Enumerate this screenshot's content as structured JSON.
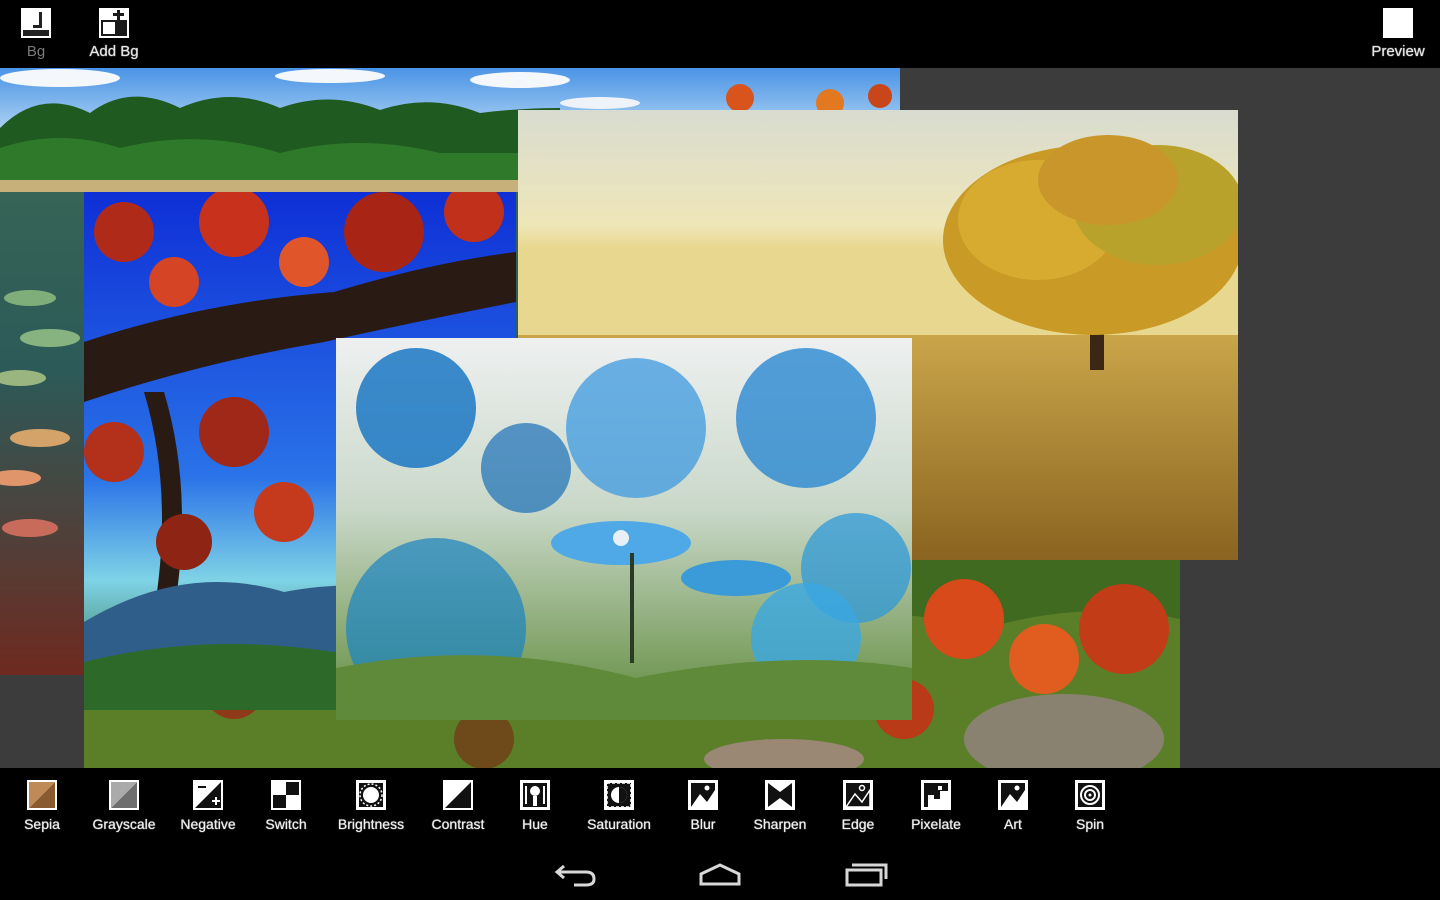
{
  "topbar": {
    "bg_label": "Bg",
    "add_bg_label": "Add Bg",
    "preview_label": "Preview"
  },
  "filters": [
    {
      "label": "Sepia",
      "icon": "sepia-icon"
    },
    {
      "label": "Grayscale",
      "icon": "grayscale-icon"
    },
    {
      "label": "Negative",
      "icon": "negative-icon"
    },
    {
      "label": "Switch",
      "icon": "switch-icon"
    },
    {
      "label": "Brightness",
      "icon": "brightness-icon"
    },
    {
      "label": "Contrast",
      "icon": "contrast-icon"
    },
    {
      "label": "Hue",
      "icon": "hue-icon"
    },
    {
      "label": "Saturation",
      "icon": "saturation-icon"
    },
    {
      "label": "Blur",
      "icon": "blur-icon"
    },
    {
      "label": "Sharpen",
      "icon": "sharpen-icon"
    },
    {
      "label": "Edge",
      "icon": "edge-icon"
    },
    {
      "label": "Pixelate",
      "icon": "pixelate-icon"
    },
    {
      "label": "Art",
      "icon": "art-icon"
    },
    {
      "label": "Spin",
      "icon": "spin-icon"
    }
  ],
  "navbar": {
    "back_icon": "back-icon",
    "home_icon": "home-icon",
    "recents_icon": "recent-apps-icon"
  },
  "photos": [
    {
      "name": "lake-forest-photo"
    },
    {
      "name": "autumn-leaves-photo"
    },
    {
      "name": "autumn-hillside-photo"
    },
    {
      "name": "lone-tree-field-photo"
    },
    {
      "name": "blue-daisies-photo"
    }
  ],
  "colors": {
    "bar_background": "#000000",
    "canvas_background": "#3c3c3c",
    "label_text": "#f0f0f0",
    "dim_label_text": "#7a7a7a"
  }
}
